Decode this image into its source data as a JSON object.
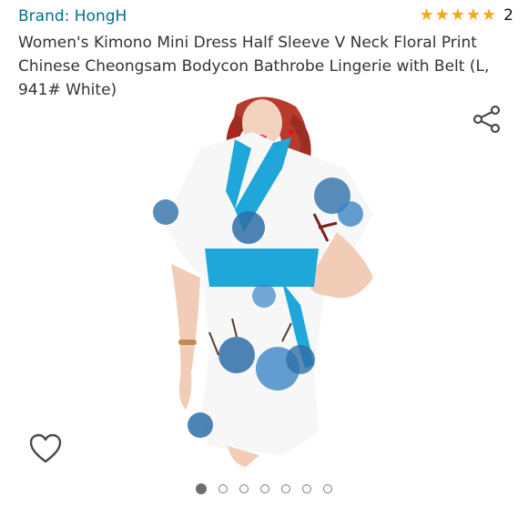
{
  "brand": {
    "text": "Brand: HongH"
  },
  "rating": {
    "stars": 5,
    "count": "2",
    "star_color": "#f5a623"
  },
  "product": {
    "title": "Women's Kimono Mini Dress Half Sleeve V Neck Floral Print Chinese Cheongsam Bodycon Bathrobe Lingerie with Belt (L, 941# White)",
    "image_icon": "product-photo"
  },
  "actions": {
    "share_icon": "share-icon",
    "wishlist_icon": "heart-icon"
  },
  "carousel": {
    "total": 7,
    "active_index": 0
  },
  "colors": {
    "link": "#007185",
    "accent_blue": "#1ea7d8"
  }
}
